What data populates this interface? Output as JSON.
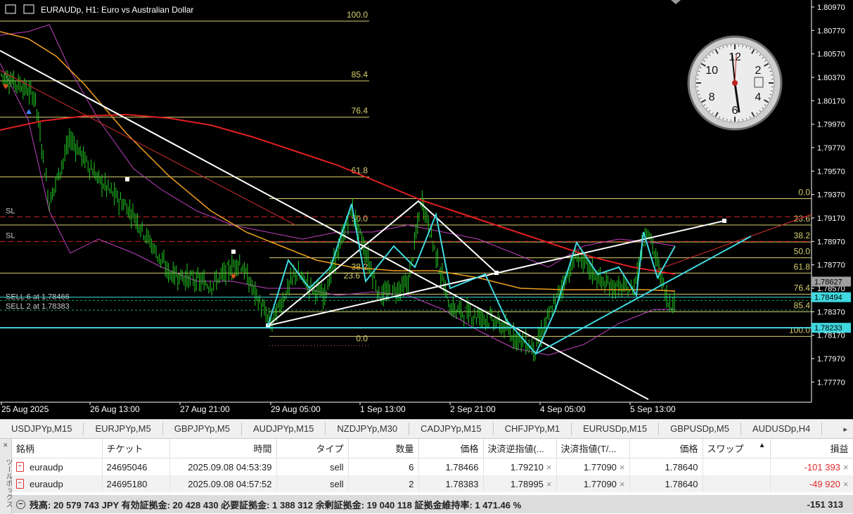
{
  "window": {
    "title": "EURAUDp, H1:  Euro vs Australian Dollar"
  },
  "chart_data": {
    "type": "candlestick",
    "symbol": "EURAUDp",
    "timeframe": "H1",
    "description": "Euro vs Australian Dollar",
    "ylim": [
      1.777,
      1.8097
    ],
    "price_ticks": [
      "1.80970",
      "1.80770",
      "1.80570",
      "1.80370",
      "1.80170",
      "1.79970",
      "1.79770",
      "1.79570",
      "1.79370",
      "1.79170",
      "1.78970",
      "1.78770",
      "1.78570",
      "1.78370",
      "1.78170",
      "1.77970",
      "1.77770"
    ],
    "time_labels": [
      "25 Aug 2025",
      "26 Aug 13:00",
      "27 Aug 21:00",
      "29 Aug 05:00",
      "1 Sep 13:00",
      "2 Sep 21:00",
      "4 Sep 05:00",
      "5 Sep 13:00"
    ],
    "price_boxes": [
      {
        "label": "1.78627",
        "price": 1.78627,
        "bg": "#a0a0a0",
        "fg": "#000000"
      },
      {
        "label": "1.78494",
        "price": 1.78494,
        "bg": "#40d8e0",
        "fg": "#000000"
      },
      {
        "label": "1.78233",
        "price": 1.78233,
        "bg": "#40d8e0",
        "fg": "#000000"
      }
    ],
    "fib_left": {
      "levels": [
        "100.0",
        "85.4",
        "76.4",
        "61.8",
        "50.0",
        "38.2",
        "23.6",
        "0.0"
      ],
      "color": "#d8d070"
    },
    "fib_right": {
      "levels": [
        "0.0",
        "23.6",
        "38.2",
        "50.0",
        "61.8",
        "76.4",
        "85.4",
        "100.0"
      ],
      "color": "#d8d070"
    },
    "order_labels": [
      "SL",
      "SL",
      "SELL 6 at 1.78466",
      "SELL 2 at 1.78383"
    ]
  },
  "tabs": [
    "USDJPYp,M15",
    "EURJPYp,M5",
    "GBPJPYp,M5",
    "AUDJPYp,M15",
    "NZDJPYp,M30",
    "CADJPYp,M15",
    "CHFJPYp,M1",
    "EURUSDp,M15",
    "GBPUSDp,M5",
    "AUDUSDp,H4"
  ],
  "tab_scroll": "▸",
  "table": {
    "headers": [
      "銘柄",
      "チケット",
      "時間",
      "タイプ",
      "数量",
      "価格",
      "決済逆指値(...",
      "決済指値(T/...",
      "価格",
      "スワップ",
      "損益"
    ],
    "sort_indicator": "▲",
    "rows": [
      {
        "symbol": "euraudp",
        "ticket": "24695046",
        "time": "2025.09.08 04:53:39",
        "type": "sell",
        "volume": "6",
        "price": "1.78466",
        "sl": "1.79210",
        "tp": "1.77090",
        "current": "1.78640",
        "swap": "",
        "profit": "-101 393"
      },
      {
        "symbol": "euraudp",
        "ticket": "24695180",
        "time": "2025.09.08 04:57:52",
        "type": "sell",
        "volume": "2",
        "price": "1.78383",
        "sl": "1.78995",
        "tp": "1.77090",
        "current": "1.78640",
        "swap": "",
        "profit": "-49 920"
      }
    ],
    "close_glyph": "×"
  },
  "summary": {
    "text": "残高: 20 579 743 JPY  有効証拠金: 20 428 430  必要証拠金: 1 388 312  余剰証拠金: 19 040 118  証拠金維持率: 1 471.46 %",
    "total": "-151 313"
  },
  "side_label": "ツールボックス",
  "colors": {
    "bg": "#000000",
    "candle": "#22cc22",
    "ma_red": "#e02020",
    "ma_orange": "#f0a020",
    "bands": "#c040c0",
    "cyan": "#40d8e0",
    "white": "#ffffff",
    "fib": "#d8d070",
    "sl_line": "#cc2222",
    "loss": "#e0292a"
  }
}
